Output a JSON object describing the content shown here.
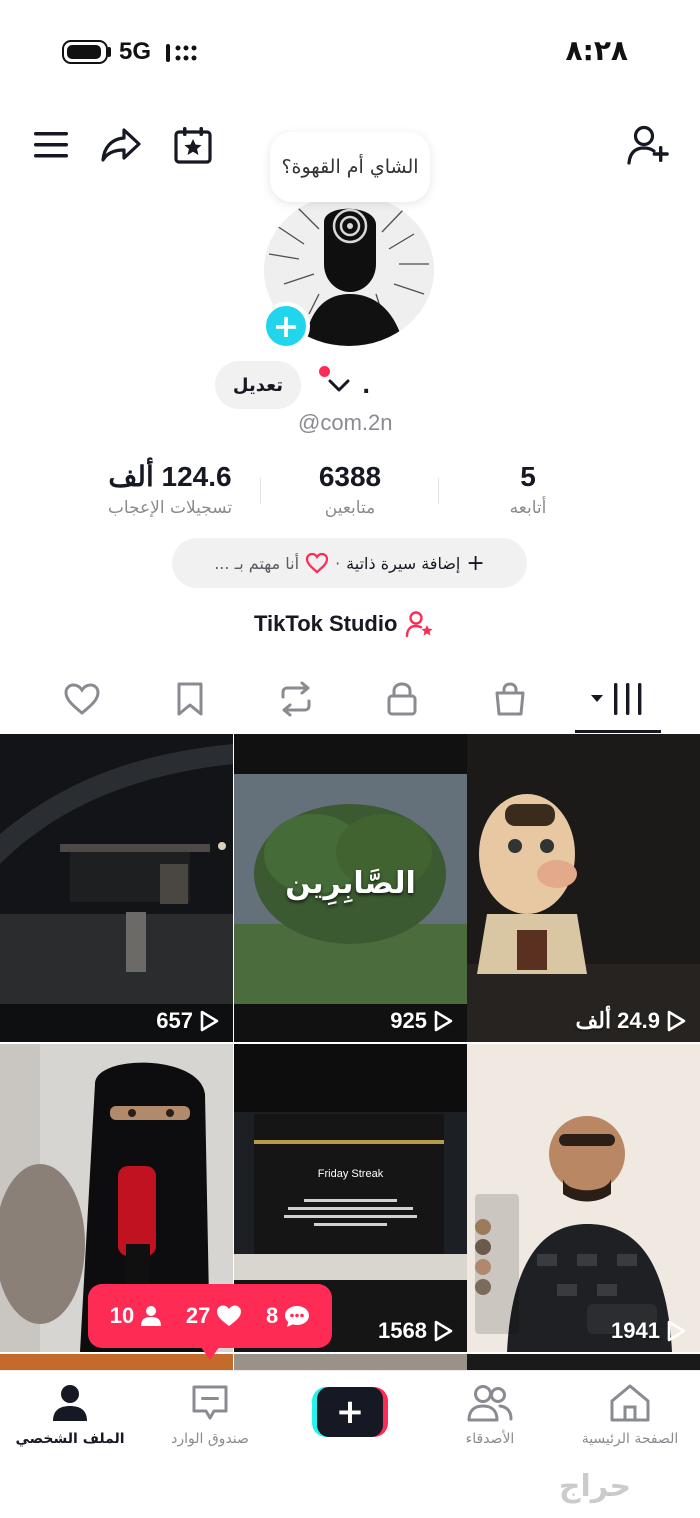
{
  "status_bar": {
    "network": "5G",
    "time": "٨:٢٨",
    "battery_level": 0.85
  },
  "header": {
    "note_text": "الشاي أم القهوة؟",
    "icons": [
      "menu-icon",
      "share-icon",
      "calendar-star-icon",
      "add-friend-icon"
    ]
  },
  "profile": {
    "edit_label": "تعديل",
    "display_name": ".",
    "username": "@com.2n"
  },
  "stats": [
    {
      "value": "5",
      "label": "أتابعه"
    },
    {
      "value": "6388",
      "label": "متابعين"
    },
    {
      "value": "124.6 ألف",
      "label": "تسجيلات الإعجاب"
    }
  ],
  "bio": {
    "add_bio": "إضافة سيرة ذاتية",
    "separator": "·",
    "interests": "أنا مهتم بـ ..."
  },
  "studio_label": "TikTok Studio",
  "tabs": [
    "videos-grid-tab",
    "shop-tab",
    "private-tab",
    "repost-tab",
    "favorites-tab",
    "liked-tab"
  ],
  "videos": [
    {
      "views": "24.9 ألف",
      "overlay": ""
    },
    {
      "views": "925",
      "overlay": "الصَّابِرِين"
    },
    {
      "views": "657",
      "overlay": ""
    },
    {
      "views": "1941",
      "overlay": ""
    },
    {
      "views": "1568",
      "overlay": "Friday Streak"
    },
    {
      "views": "",
      "overlay": ""
    }
  ],
  "activity": {
    "comments": "8",
    "likes": "27",
    "followers": "10"
  },
  "nav": {
    "home": "الصفحة الرئيسية",
    "friends": "الأصدقاء",
    "create": "+",
    "inbox": "صندوق الوارد",
    "profile": "الملف الشخصي"
  },
  "watermark": "حراج",
  "colors": {
    "accent": "#fe2c55",
    "cyan": "#25f4ee",
    "badge": "#20d5ec"
  }
}
